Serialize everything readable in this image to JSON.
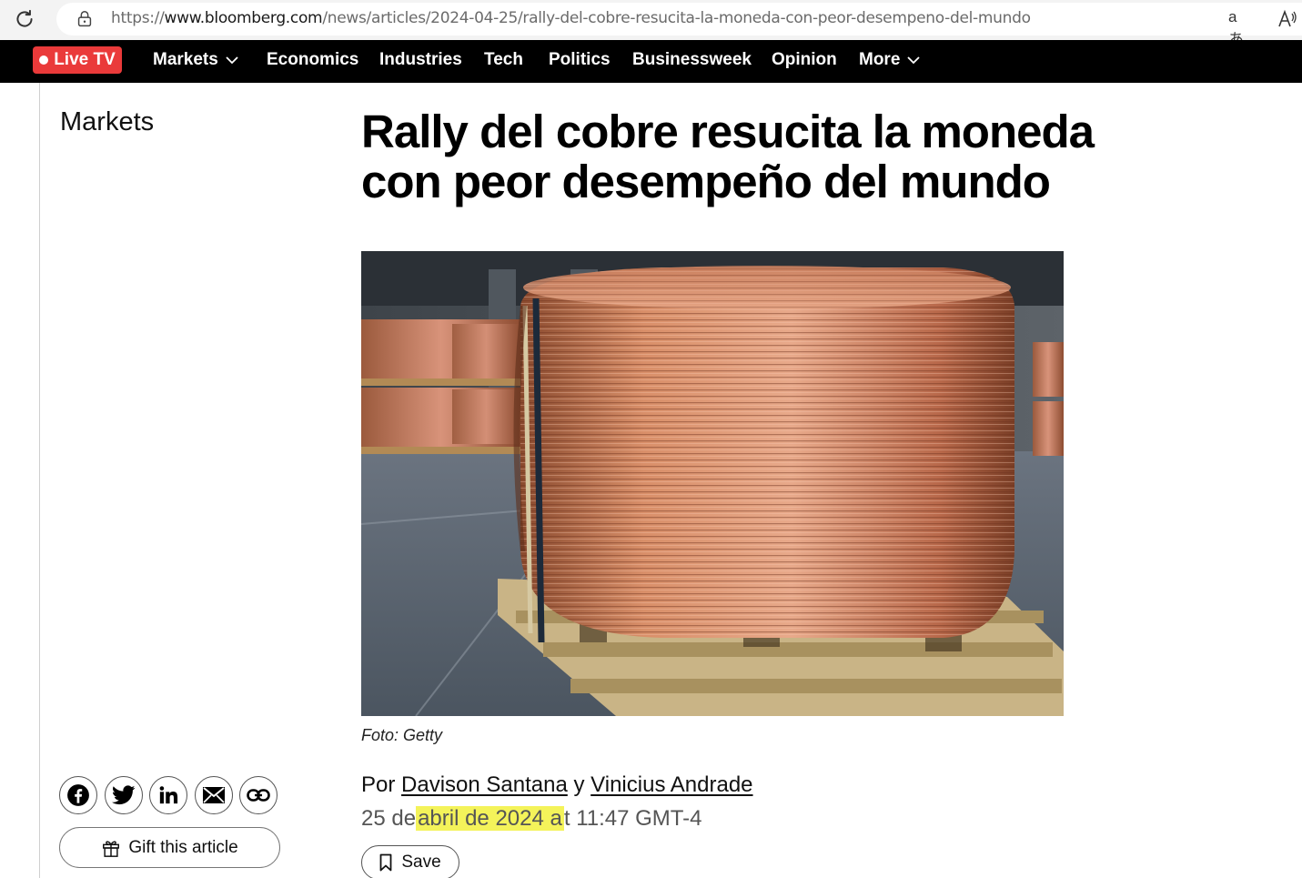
{
  "browser": {
    "url_prefix": "https://",
    "url_domain": "www.bloomberg.com",
    "url_path": "/news/articles/2024-04-25/rally-del-cobre-resucita-la-moneda-con-peor-desempeno-del-mundo",
    "translate_glyph": "aあ",
    "read_aloud_glyph": "Aͅ"
  },
  "nav": {
    "live_tv": "Live TV",
    "items": [
      {
        "label": "Markets",
        "has_dropdown": true
      },
      {
        "label": "Economics",
        "has_dropdown": false
      },
      {
        "label": "Industries",
        "has_dropdown": false
      },
      {
        "label": "Tech",
        "has_dropdown": false
      },
      {
        "label": "Politics",
        "has_dropdown": false
      },
      {
        "label": "Businessweek",
        "has_dropdown": false
      },
      {
        "label": "Opinion",
        "has_dropdown": false
      },
      {
        "label": "More",
        "has_dropdown": true
      }
    ]
  },
  "article": {
    "section": "Markets",
    "headline": "Rally del cobre resucita la moneda con peor desempeño del mundo",
    "caption": "Foto: Getty",
    "byline_prefix": "Por",
    "author1": "Davison Santana",
    "byline_join": "y",
    "author2": "Vinicius Andrade",
    "date_pre": "25 de",
    "date_highlight": "abril de 2024 a",
    "date_post": "t 11:47 GMT-4",
    "save_label": "Save"
  },
  "share": {
    "gift_label": "Gift this article"
  },
  "colors": {
    "nav_bg": "#000000",
    "live_tv": "#ea3a3a",
    "highlight": "#f4f35a"
  }
}
